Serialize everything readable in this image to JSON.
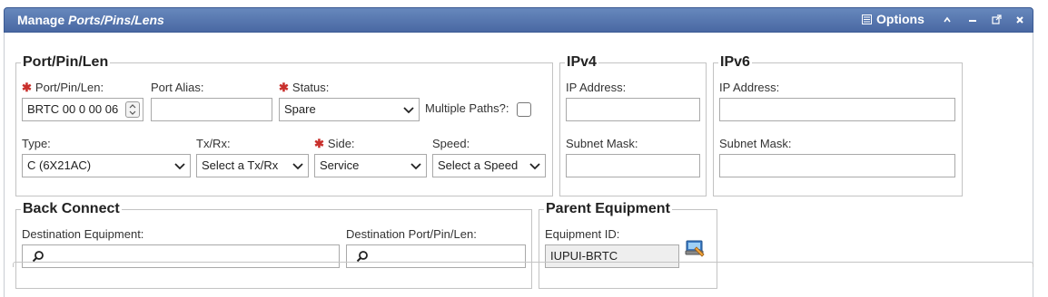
{
  "window": {
    "title_prefix": "Manage ",
    "title_italic": "Ports/Pins/Lens",
    "options_label": "Options"
  },
  "port_section": {
    "legend": "Port/Pin/Len",
    "port_label": "Port/Pin/Len:",
    "port_value": "BRTC 00 0 00 06",
    "alias_label": "Port Alias:",
    "alias_value": "",
    "status_label": "Status:",
    "status_value": "Spare",
    "multiple_paths_label": "Multiple Paths?:",
    "multiple_paths_checked": false,
    "type_label": "Type:",
    "type_value": "C (6X21AC)",
    "txrx_label": "Tx/Rx:",
    "txrx_value": "Select a Tx/Rx",
    "side_label": "Side:",
    "side_value": "Service",
    "speed_label": "Speed:",
    "speed_value": "Select a Speed"
  },
  "ipv4": {
    "legend": "IPv4",
    "ip_label": "IP Address:",
    "ip_value": "",
    "mask_label": "Subnet Mask:",
    "mask_value": ""
  },
  "ipv6": {
    "legend": "IPv6",
    "ip_label": "IP Address:",
    "ip_value": "",
    "mask_label": "Subnet Mask:",
    "mask_value": ""
  },
  "back_connect": {
    "legend": "Back Connect",
    "dest_equipment_label": "Destination Equipment:",
    "dest_equipment_value": "",
    "dest_port_label": "Destination Port/Pin/Len:",
    "dest_port_value": ""
  },
  "parent_equipment": {
    "legend": "Parent Equipment",
    "equipment_id_label": "Equipment ID:",
    "equipment_id_value": "IUPUI-BRTC"
  },
  "colors": {
    "titlebar": "#5677b2",
    "required": "#c9302c"
  },
  "icons": {
    "options": "list-icon",
    "collapse": "chevron-up-icon",
    "minimize": "minimize-icon",
    "popout": "popout-icon",
    "close": "close-icon",
    "search": "magnifier-icon",
    "equipment": "equipment-lookup-icon"
  }
}
